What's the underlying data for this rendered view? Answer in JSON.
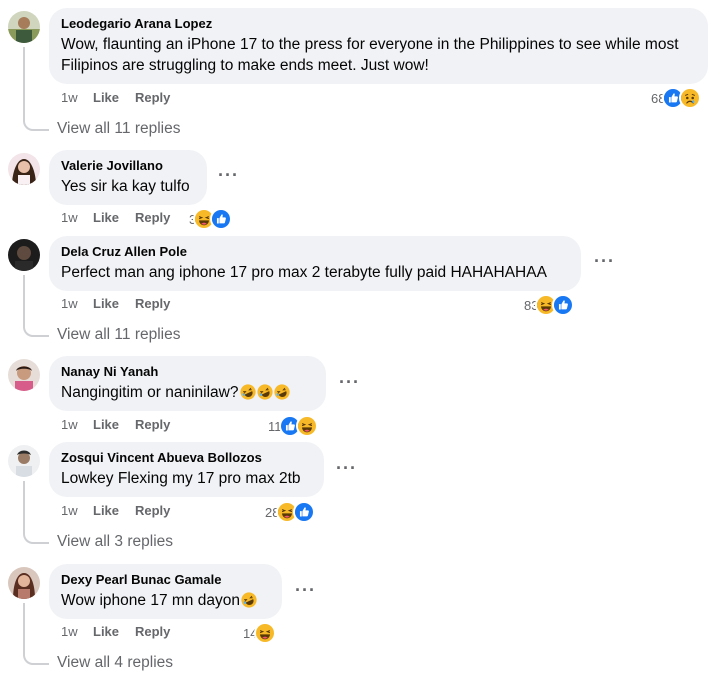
{
  "comments": [
    {
      "name": "Leodegario Arana Lopez",
      "text": "Wow, flaunting an iPhone 17 to the press for everyone in the Philippines to see while most Filipinos are struggling to make ends meet. Just wow!",
      "time": "1w",
      "like": "Like",
      "reply": "Reply",
      "reaction_count": "68",
      "reactions": [
        "like",
        "sad"
      ],
      "view_replies": "View all 11 replies"
    },
    {
      "name": "Valerie Jovillano",
      "text": "Yes sir ka kay tulfo",
      "time": "1w",
      "like": "Like",
      "reply": "Reply",
      "reaction_count": "3",
      "reactions": [
        "haha",
        "like"
      ]
    },
    {
      "name": "Dela Cruz Allen Pole",
      "text": "Perfect man ang iphone 17 pro max 2 terabyte fully paid HAHAHAHAA",
      "time": "1w",
      "like": "Like",
      "reply": "Reply",
      "reaction_count": "83",
      "reactions": [
        "haha",
        "like"
      ],
      "view_replies": "View all 11 replies"
    },
    {
      "name": "Nanay Ni Yanah",
      "text": "Nangingitim or naninilaw?",
      "text_emojis": [
        "rofl",
        "rofl",
        "rofl"
      ],
      "time": "1w",
      "like": "Like",
      "reply": "Reply",
      "reaction_count": "11",
      "reactions": [
        "like",
        "haha"
      ]
    },
    {
      "name": "Zosqui Vincent Abueva Bollozos",
      "text": "Lowkey Flexing my 17 pro max 2tb",
      "time": "1w",
      "like": "Like",
      "reply": "Reply",
      "reaction_count": "28",
      "reactions": [
        "haha",
        "like"
      ],
      "view_replies": "View all 3 replies"
    },
    {
      "name": "Dexy Pearl Bunac Gamale",
      "text": "Wow iphone 17 mn dayon",
      "text_emojis": [
        "rofl"
      ],
      "time": "1w",
      "like": "Like",
      "reply": "Reply",
      "reaction_count": "14",
      "reactions": [
        "haha"
      ],
      "view_replies": "View all 4 replies"
    }
  ],
  "more_options": "···",
  "colors": {
    "like_blue": "#1877f2",
    "emoji_yellow": "#f7b928",
    "bubble": "#f0f2f5",
    "meta": "#65676b"
  }
}
